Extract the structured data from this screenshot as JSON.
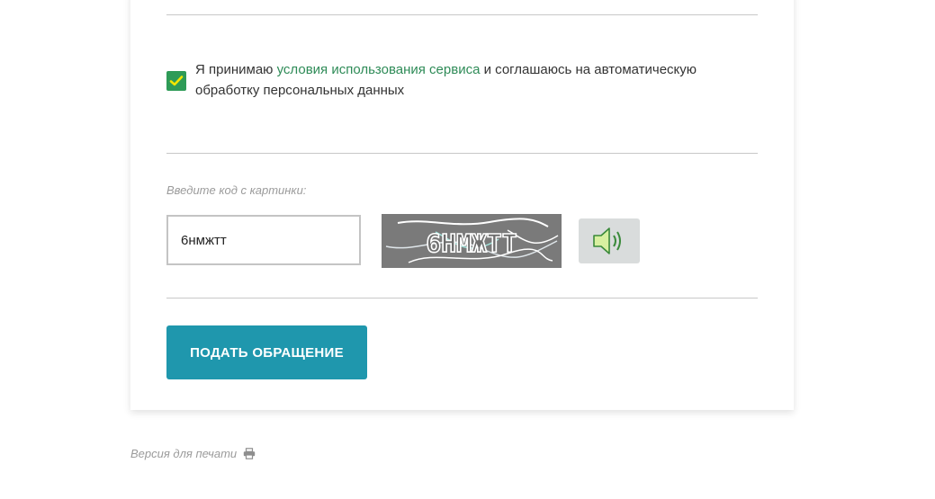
{
  "consent": {
    "checked": true,
    "text_before": "Я принимаю ",
    "link_text": "условия использования сервиса",
    "text_after": " и соглашаюсь на автоматическую обработку персональных данных"
  },
  "captcha": {
    "label": "Введите код с картинки:",
    "input_value": "6нмжтт",
    "image_text": "6НМЖТТ",
    "audio_icon": "speaker-icon"
  },
  "submit": {
    "label": "ПОДАТЬ ОБРАЩЕНИЕ"
  },
  "print": {
    "label": "Версия для печати",
    "icon": "printer-icon"
  },
  "colors": {
    "accent_green": "#2e8b57",
    "checkbox_green": "#2e9b57",
    "button_teal": "#1f97ad",
    "muted_text": "#9b9b9b"
  }
}
